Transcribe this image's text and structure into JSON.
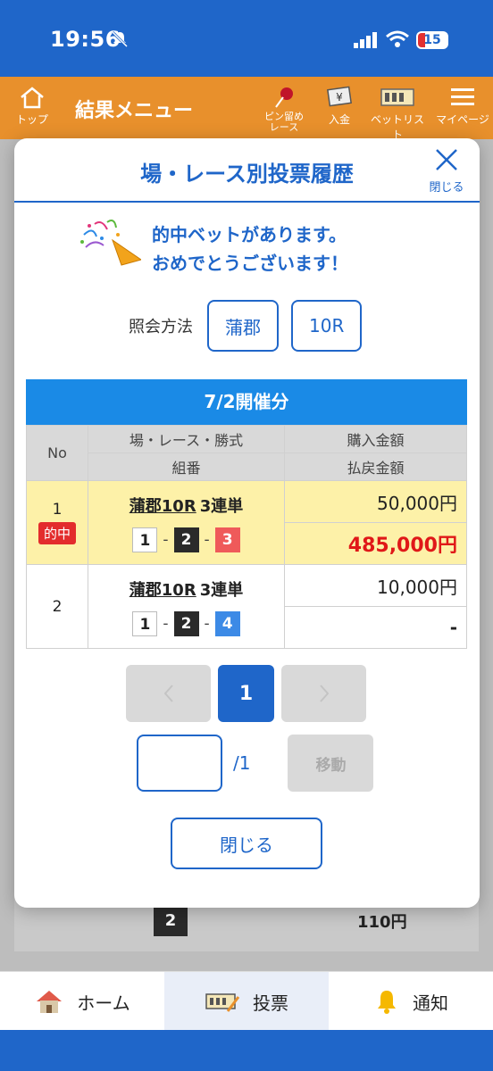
{
  "status_bar": {
    "time": "19:56",
    "battery": "15"
  },
  "app_bar": {
    "home": "トップ",
    "title": "結果メニュー",
    "pin": "ピン留め\nレース",
    "deposit": "入金",
    "betlist": "ベットリスト",
    "mypage": "マイページ"
  },
  "background": {
    "row_num": "2",
    "price_1": "110円"
  },
  "modal": {
    "title": "場・レース別投票履歴",
    "close_x_label": "閉じる",
    "congrats": {
      "line1": "的中ベットがあります。",
      "line2": "おめでとうございます！"
    },
    "query": {
      "label": "照会方法",
      "venue": "蒲郡",
      "race": "10R"
    },
    "date_header": "7/2開催分",
    "table": {
      "headers": {
        "no": "No",
        "race_type": "場・レース・勝式",
        "purchase": "購入金額",
        "combo": "組番",
        "payout": "払戻金額"
      },
      "rows": [
        {
          "no": "1",
          "badge": "的中",
          "venue_race": "蒲郡10R",
          "bet_type": "3連単",
          "combo": [
            "1",
            "2",
            "3"
          ],
          "purchase": "50,000円",
          "payout": "485,000円"
        },
        {
          "no": "2",
          "venue_race": "蒲郡10R",
          "bet_type": "3連単",
          "combo": [
            "1",
            "2",
            "4"
          ],
          "purchase": "10,000円",
          "payout": "-"
        }
      ]
    },
    "pager": {
      "current": "1",
      "total": "/1",
      "go": "移動"
    },
    "close_button": "閉じる"
  },
  "bottom_nav": {
    "home": "ホーム",
    "vote": "投票",
    "notify": "通知"
  }
}
